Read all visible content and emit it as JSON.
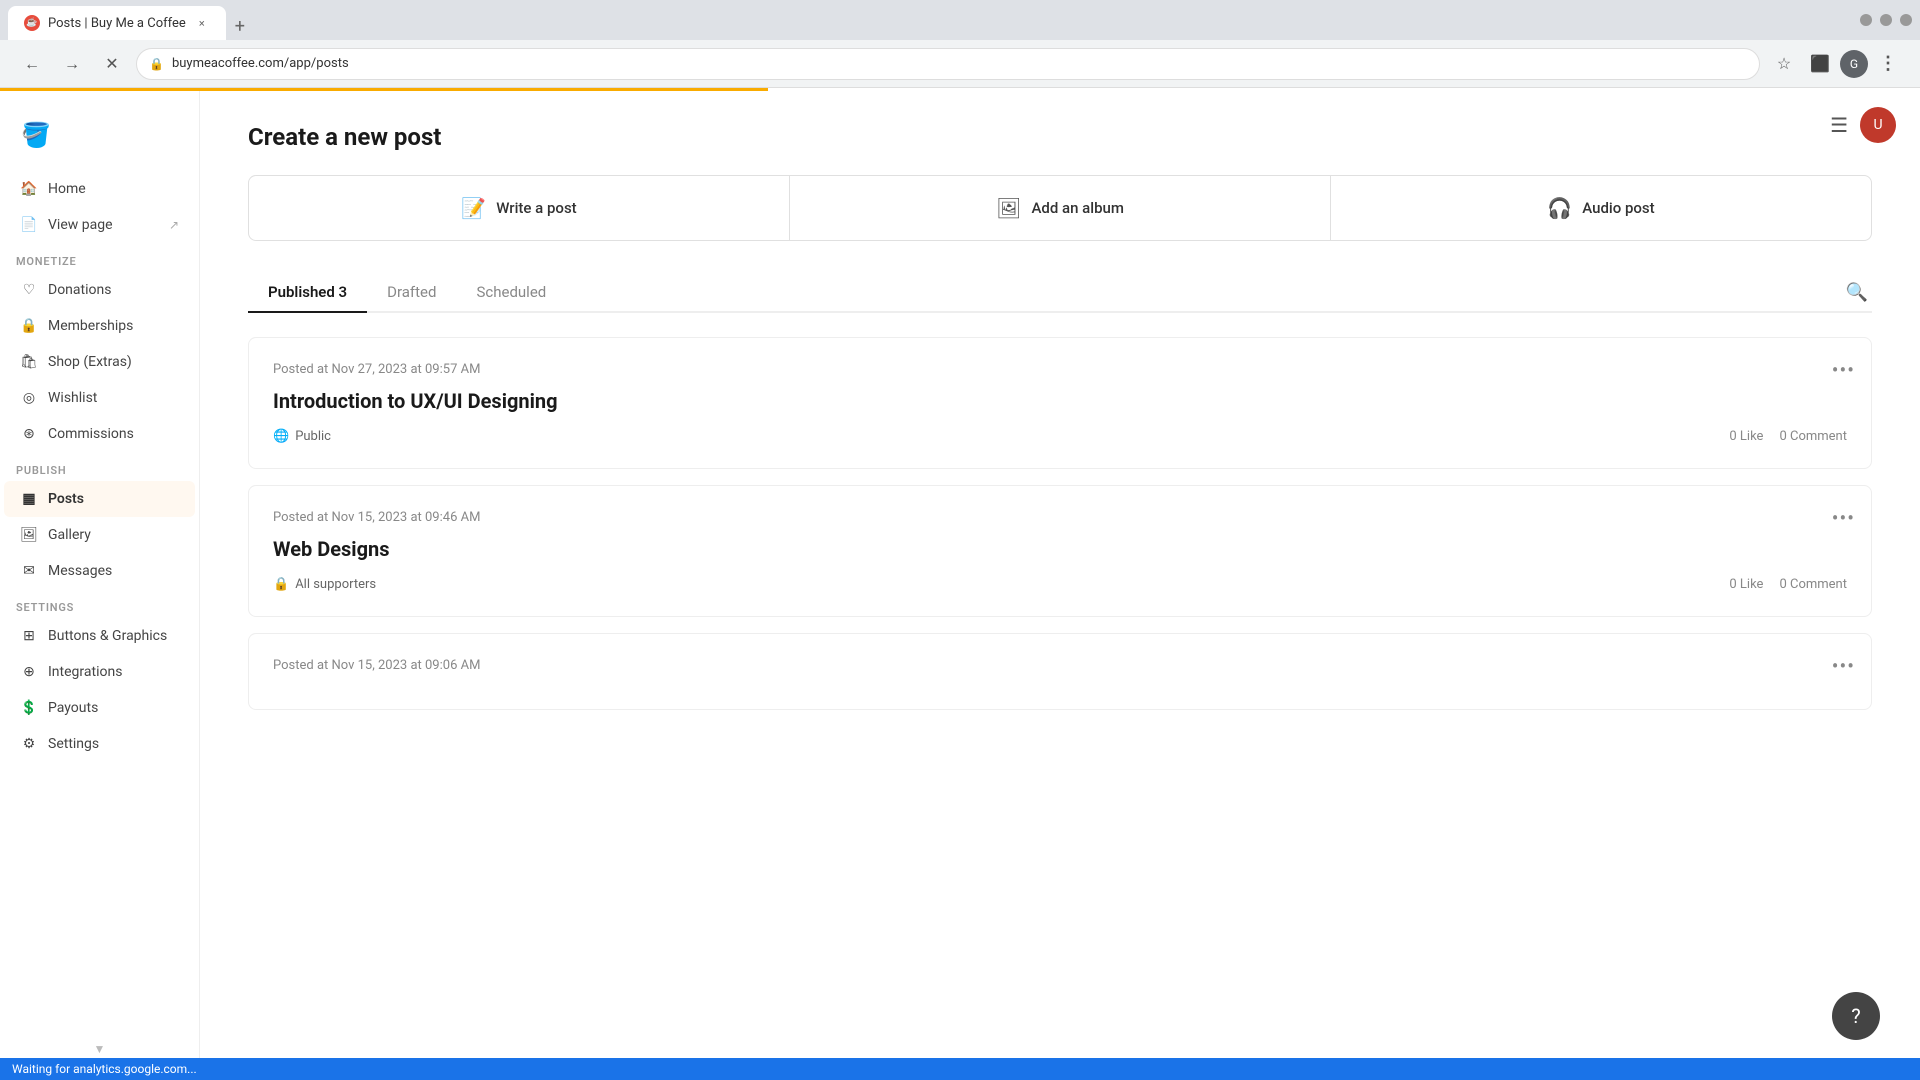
{
  "browser": {
    "tab_title": "Posts | Buy Me a Coffee",
    "tab_favicon": "☕",
    "new_tab_icon": "+",
    "close_icon": "×",
    "url": "buymeacoffee.com/app/posts",
    "nav_back": "←",
    "nav_forward": "→",
    "nav_refresh": "✕",
    "status_text": "Waiting for analytics.google.com..."
  },
  "header": {
    "hamburger": "☰",
    "avatar_initials": "U"
  },
  "sidebar": {
    "logo_emoji": "🪣",
    "items_main": [
      {
        "id": "home",
        "label": "Home",
        "icon": "🏠"
      },
      {
        "id": "view-page",
        "label": "View page",
        "icon": "📄",
        "external": true
      }
    ],
    "section_monetize": "MONETIZE",
    "items_monetize": [
      {
        "id": "donations",
        "label": "Donations",
        "icon": "♡"
      },
      {
        "id": "memberships",
        "label": "Memberships",
        "icon": "🔒"
      },
      {
        "id": "shop-extras",
        "label": "Shop (Extras)",
        "icon": "🛍"
      },
      {
        "id": "wishlist",
        "label": "Wishlist",
        "icon": "⊙"
      },
      {
        "id": "commissions",
        "label": "Commissions",
        "icon": "◎"
      }
    ],
    "section_publish": "PUBLISH",
    "items_publish": [
      {
        "id": "posts",
        "label": "Posts",
        "icon": "▦",
        "active": true
      },
      {
        "id": "gallery",
        "label": "Gallery",
        "icon": "🖼"
      },
      {
        "id": "messages",
        "label": "Messages",
        "icon": "✉"
      }
    ],
    "section_settings": "SETTINGS",
    "items_settings": [
      {
        "id": "buttons-graphics",
        "label": "Buttons & Graphics",
        "icon": "⊞"
      },
      {
        "id": "integrations",
        "label": "Integrations",
        "icon": "⊕"
      },
      {
        "id": "payouts",
        "label": "Payouts",
        "icon": "💲"
      },
      {
        "id": "settings",
        "label": "Settings",
        "icon": "⚙"
      }
    ]
  },
  "main": {
    "page_title": "Create a new post",
    "create_options": [
      {
        "id": "write-post",
        "label": "Write a post",
        "icon": "📝"
      },
      {
        "id": "add-album",
        "label": "Add an album",
        "icon": "🖼"
      },
      {
        "id": "audio-post",
        "label": "Audio post",
        "icon": "🎧"
      }
    ],
    "tabs": [
      {
        "id": "published",
        "label": "Published 3",
        "active": true
      },
      {
        "id": "drafted",
        "label": "Drafted",
        "active": false
      },
      {
        "id": "scheduled",
        "label": "Scheduled",
        "active": false
      }
    ],
    "posts": [
      {
        "id": "post-1",
        "meta": "Posted at Nov 27, 2023 at 09:57 AM",
        "title": "Introduction to UX/UI Designing",
        "visibility": "Public",
        "visibility_icon": "🌐",
        "likes": "0 Like",
        "comments": "0 Comment"
      },
      {
        "id": "post-2",
        "meta": "Posted at Nov 15, 2023 at 09:46 AM",
        "title": "Web Designs",
        "visibility": "All supporters",
        "visibility_icon": "🔒",
        "likes": "0 Like",
        "comments": "0 Comment"
      },
      {
        "id": "post-3",
        "meta": "Posted at Nov 15, 2023 at 09:06 AM",
        "title": "",
        "visibility": "",
        "visibility_icon": "",
        "likes": "",
        "comments": ""
      }
    ],
    "help_icon": "?",
    "menu_dots": "•••"
  }
}
